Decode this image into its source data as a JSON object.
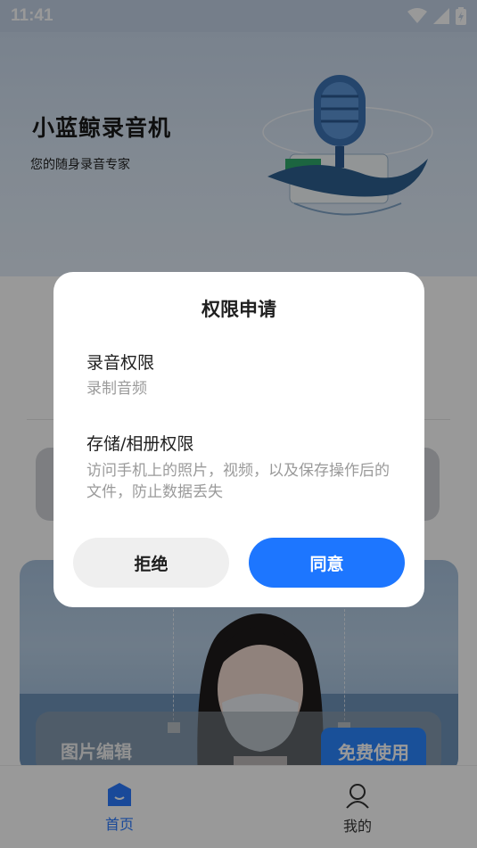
{
  "status_bar": {
    "time": "11:41",
    "icons": [
      "wifi-icon",
      "signal-icon",
      "battery-charging-icon"
    ]
  },
  "hero": {
    "app_title": "小蓝鲸录音机",
    "subtitle": "您的随身录音专家"
  },
  "photo_card": {
    "label": "图片编辑",
    "action_label": "免费使用"
  },
  "tab_bar": {
    "tabs": [
      {
        "label": "首页",
        "icon": "home-icon",
        "active": true
      },
      {
        "label": "我的",
        "icon": "profile-icon",
        "active": false
      }
    ]
  },
  "dialog": {
    "title": "权限申请",
    "permissions": [
      {
        "name": "录音权限",
        "description": "录制音频"
      },
      {
        "name": "存储/相册权限",
        "description": "访问手机上的照片，视频，以及保存操作后的文件，防止数据丢失"
      }
    ],
    "reject_label": "拒绝",
    "agree_label": "同意"
  },
  "colors": {
    "accent": "#1d76ff",
    "tab_active": "#2b7bff",
    "muted_text": "#9a9a9a"
  }
}
